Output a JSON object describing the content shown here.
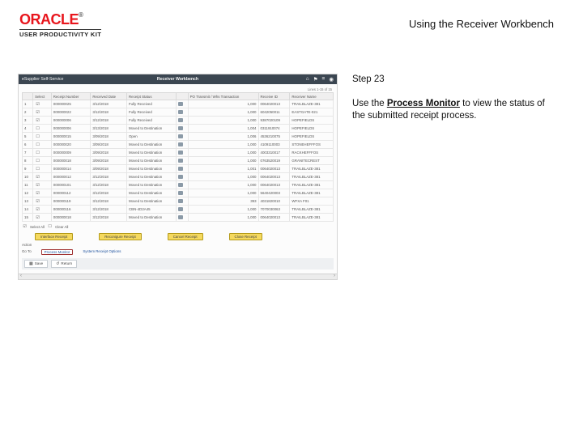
{
  "header": {
    "brand": "ORACLE",
    "kit": "USER PRODUCTIVITY KIT",
    "page_title": "Using the Receiver Workbench"
  },
  "instructions": {
    "step_label": "Step 23",
    "body_pre": "Use the ",
    "body_link": "Process Monitor",
    "body_post": " to view the status of the submitted receipt process."
  },
  "workbench": {
    "app_name": "eSupplier Self-Service",
    "window_title": "Receiver Workbench",
    "icons": {
      "home": "⌂",
      "flag": "⚑",
      "menu": "≡",
      "help": "◉"
    },
    "paging_label": "Lines 1-15 of 15",
    "columns": [
      "",
      "Select",
      "Receipt Number",
      "Received Date",
      "Receipt Status",
      "",
      "PO Transmit / Whs Transaction",
      "Receive ID",
      "Receiver Name"
    ],
    "rows": [
      {
        "n": "1",
        "ck": "☑",
        "rcpt": "000000025",
        "date": "3/12/2018",
        "status": "Fully Received",
        "qty": "1,000",
        "trans": "0064020013",
        "name": "TRAILBLAZE-381"
      },
      {
        "n": "2",
        "ck": "☑",
        "rcpt": "000000022",
        "date": "3/12/2018",
        "status": "Fully Received",
        "qty": "1,000",
        "trans": "6042050011",
        "name": "EASTGATE-021"
      },
      {
        "n": "3",
        "ck": "☑",
        "rcpt": "000000006",
        "date": "3/12/2018",
        "status": "Fully Received",
        "qty": "1,000",
        "trans": "9387020109",
        "name": "HOPEFIELDS"
      },
      {
        "n": "4",
        "ck": "☐",
        "rcpt": "000000006",
        "date": "3/13/2018",
        "status": "Moved to Destination",
        "qty": "1,004",
        "trans": "0311910074",
        "name": "HOPEFIELDS"
      },
      {
        "n": "5",
        "ck": "☐",
        "rcpt": "000000015",
        "date": "3/09/2018",
        "status": "Open",
        "qty": "1,006",
        "trans": "4536210075",
        "name": "HOPEFIELDS"
      },
      {
        "n": "6",
        "ck": "☐",
        "rcpt": "000000020",
        "date": "3/09/2018",
        "status": "Moved to Destination",
        "qty": "1,000",
        "trans": "4109110003",
        "name": "STONEHEFFFOS"
      },
      {
        "n": "7",
        "ck": "☐",
        "rcpt": "000000009",
        "date": "3/09/2018",
        "status": "Moved to Destination",
        "qty": "1,000",
        "trans": "4003310017",
        "name": "RACKHEFFFOS"
      },
      {
        "n": "8",
        "ck": "☐",
        "rcpt": "000000018",
        "date": "3/09/2018",
        "status": "Moved to Destination",
        "qty": "1,000",
        "trans": "0763520019",
        "name": "GRANITECREST"
      },
      {
        "n": "9",
        "ck": "☐",
        "rcpt": "000000014",
        "date": "3/09/2018",
        "status": "Moved to Destination",
        "qty": "1,001",
        "trans": "0064020013",
        "name": "TRAILBLAZE-381"
      },
      {
        "n": "10",
        "ck": "☑",
        "rcpt": "000000012",
        "date": "3/12/2018",
        "status": "Moved to Destination",
        "qty": "1,000",
        "trans": "0064020013",
        "name": "TRAILBLAZE-381"
      },
      {
        "n": "11",
        "ck": "☑",
        "rcpt": "000000101",
        "date": "3/12/2018",
        "status": "Moved to Destination",
        "qty": "1,000",
        "trans": "0064020013",
        "name": "TRAILBLAZE-381"
      },
      {
        "n": "12",
        "ck": "☑",
        "rcpt": "000000112",
        "date": "3/12/2018",
        "status": "Moved to Destination",
        "qty": "1,000",
        "trans": "5640420003",
        "name": "TRAILBLAZE-381"
      },
      {
        "n": "13",
        "ck": "☑",
        "rcpt": "000000119",
        "date": "3/12/2018",
        "status": "Moved to Destination",
        "qty": "393",
        "trans": "4031820010",
        "name": "WFXA F01"
      },
      {
        "n": "14",
        "ck": "☑",
        "rcpt": "000000116",
        "date": "3/12/2018",
        "status": "CBN-4D2A45",
        "qty": "1,000",
        "trans": "7070030063",
        "name": "TRAILBLAZE-381"
      },
      {
        "n": "15",
        "ck": "☑",
        "rcpt": "000000018",
        "date": "3/12/2018",
        "status": "Moved to Destination",
        "qty": "1,000",
        "trans": "0064020013",
        "name": "TRAILBLAZE-381"
      }
    ],
    "select_all": "Select All",
    "clear_all": "Clear All",
    "action_label": "Action",
    "goto_label": "Go To",
    "buttons": {
      "interface": "Interface Receipt",
      "reconcile": "Reconigure Receipt",
      "cancel": "Cancel Receipt",
      "close": "Close Receipt"
    },
    "links": {
      "process_monitor": "Process Monitor",
      "system_options": "System Receipt Options"
    },
    "tabs": {
      "save": "Save",
      "return": "Return"
    }
  }
}
